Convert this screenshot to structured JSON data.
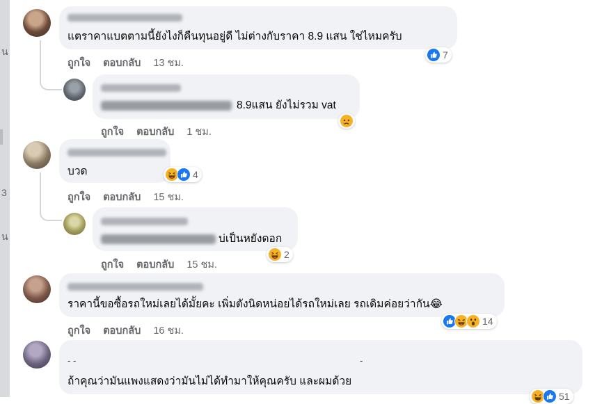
{
  "left_strip": {
    "fragments": [
      "น",
      "3",
      "น"
    ]
  },
  "comments": [
    {
      "text": "แตราคาแบตตามนี้ยังไงก็คืนทุนอยู่ดี ไม่ต่างกับราคา 8.9 แสน ใช่ไหมครับ",
      "like_label": "ถูกใจ",
      "reply_label": "ตอบกลับ",
      "time": "13 ชม.",
      "reactions": [
        "like"
      ],
      "reaction_count": "7"
    },
    {
      "text": "8.9แสน ยังไม่รวม vat",
      "like_label": "ถูกใจ",
      "reply_label": "ตอบกลับ",
      "time": "1 ชม.",
      "reactions": [
        "sad"
      ],
      "reaction_count": ""
    },
    {
      "text": "บวด",
      "like_label": "ถูกใจ",
      "reply_label": "ตอบกลับ",
      "time": "15 ชม.",
      "reactions": [
        "haha",
        "like"
      ],
      "reaction_count": "4"
    },
    {
      "text": "บ่เป็นหยังดอก",
      "like_label": "ถูกใจ",
      "reply_label": "ตอบกลับ",
      "time": "15 ชม.",
      "reactions": [
        "haha"
      ],
      "reaction_count": "2"
    },
    {
      "text": "ราคานี้ขอซื้อรถใหม่เลยได้มั้ยคะ เพิ่มตังนิดหน่อยได้รถใหม่เลย รถเดิมค่อยว่ากัน😂",
      "like_label": "ถูกใจ",
      "reply_label": "ตอบกลับ",
      "time": "16 ชม.",
      "reactions": [
        "like",
        "haha",
        "wow"
      ],
      "reaction_count": "14"
    },
    {
      "text_line1_left": "- -",
      "text_line1_right": "-",
      "text": "ถ้าคุณว่ามันแพงแสดงว่ามันไม่ได้ทำมาให้คุณครับ และผมด้วย",
      "reactions": [
        "haha",
        "like"
      ],
      "reaction_count": "51"
    }
  ],
  "colors": {
    "like_blue": "#1877f2",
    "bubble_bg": "#f0f2f5",
    "meta_gray": "#65676b",
    "emoji_yellow": "#f7b125"
  }
}
